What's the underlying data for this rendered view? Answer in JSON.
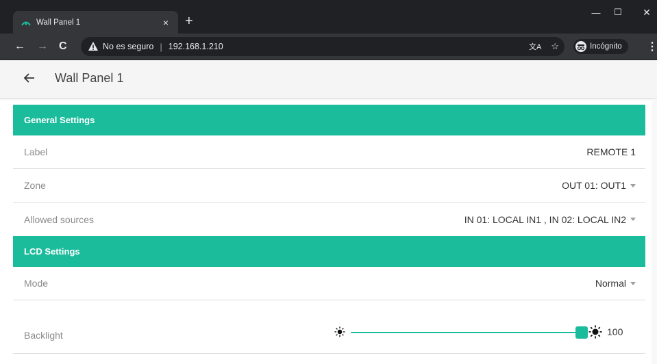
{
  "browser": {
    "tab_title": "Wall Panel 1",
    "tab_close": "×",
    "new_tab": "+",
    "not_secure": "No es seguro",
    "url": "192.168.1.210",
    "incognito": "Incógnito",
    "win_minimize": "—",
    "win_maximize": "☐",
    "win_close": "✕"
  },
  "header": {
    "title": "Wall Panel 1",
    "back_icon": "arrow-left-icon"
  },
  "sections": {
    "general": {
      "title": "General Settings",
      "label_name": "Label",
      "label_value": "REMOTE 1",
      "zone_name": "Zone",
      "zone_value": "OUT 01: OUT1",
      "sources_name": "Allowed sources",
      "sources_value": "IN 01: LOCAL IN1 , IN 02: LOCAL IN2"
    },
    "lcd": {
      "title": "LCD Settings",
      "mode_name": "Mode",
      "mode_value": "Normal",
      "backlight_name": "Backlight",
      "backlight_value": "100",
      "backlight_level": 100
    }
  },
  "colors": {
    "accent": "#1bbc9b",
    "chrome_dark": "#202124",
    "chrome_toolbar": "#35363a"
  }
}
